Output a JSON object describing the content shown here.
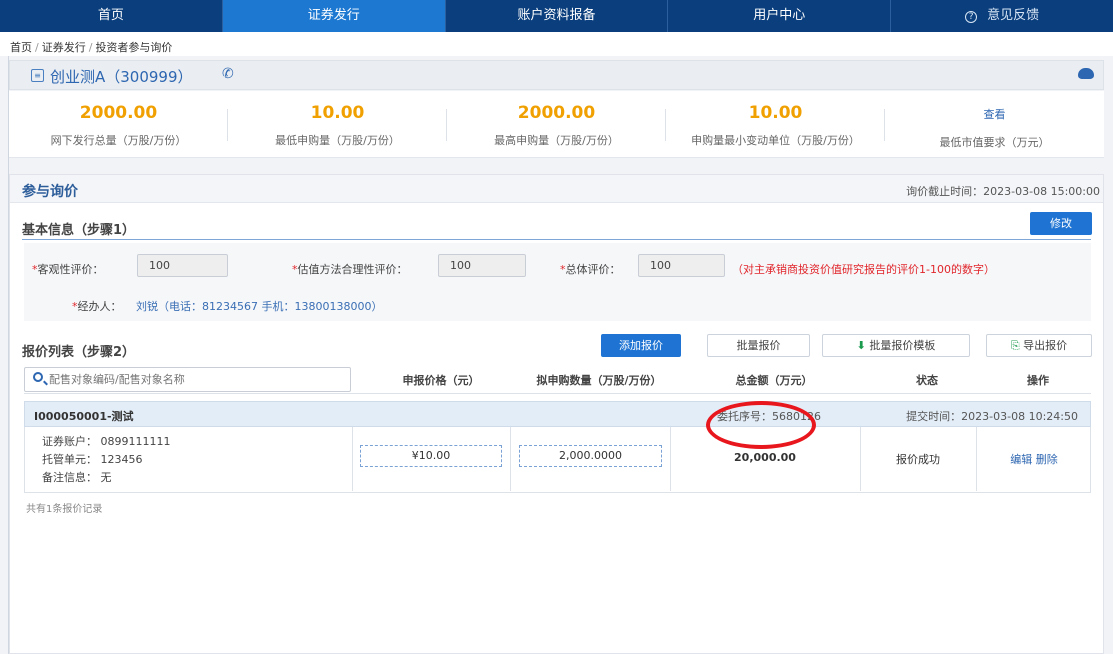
{
  "nav": {
    "home": "首页",
    "issuance": "证券发行",
    "account_report": "账户资料报备",
    "user_center": "用户中心",
    "feedback": "意见反馈"
  },
  "breadcrumb": {
    "home": "首页",
    "issuance": "证券发行",
    "current": "投资者参与询价"
  },
  "product": {
    "name": "创业测A（300999）"
  },
  "stats": [
    {
      "value": "2000.00",
      "label": "网下发行总量（万股/万份）"
    },
    {
      "value": "10.00",
      "label": "最低申购量（万股/万份）"
    },
    {
      "value": "2000.00",
      "label": "最高申购量（万股/万份）"
    },
    {
      "value": "10.00",
      "label": "申购量最小变动单位（万股/万份）"
    },
    {
      "value": "查看",
      "label": "最低市值要求（万元）"
    }
  ],
  "inquiry": {
    "title": "参与询价",
    "deadline": "询价截止时间：2023-03-08 15:00:00"
  },
  "basic_info": {
    "title": "基本信息（步骤1）",
    "modify_button": "修改",
    "objectivity_label": "客观性评价：",
    "objectivity_value": "100",
    "valuation_label": "估值方法合理性评价：",
    "valuation_value": "100",
    "overall_label": "总体评价：",
    "overall_value": "100",
    "hint": "（对主承销商投资价值研究报告的评价1-100的数字）",
    "handler_label": "经办人：",
    "handler_value": "刘锐（电话：81234567 手机：13800138000）"
  },
  "quote_list": {
    "title": "报价列表（步骤2）",
    "add_button": "添加报价",
    "batch_button": "批量报价",
    "template_button": "批量报价模板",
    "export_button": "导出报价",
    "search_placeholder": "配售对象编码/配售对象名称",
    "columns": {
      "price": "申报价格（元）",
      "quantity": "拟申购数量（万股/万份）",
      "amount": "总金额（万元）",
      "status": "状态",
      "action": "操作"
    },
    "group": {
      "name": "I000050001-测试",
      "seq_label": "委托序号：",
      "seq_value": "5680126",
      "submit_time": "提交时间：2023-03-08 10:24:50"
    },
    "row": {
      "account": "证券账户： 0899111111",
      "custody": "托管单元： 123456",
      "remark": "备注信息： 无",
      "price": "¥10.00",
      "quantity": "2,000.0000",
      "amount": "20,000.00",
      "status": "报价成功",
      "edit": "编辑",
      "delete": "删除"
    },
    "footnote": "共有1条报价记录"
  },
  "colors": {
    "nav_bg": "#0a3e7d",
    "nav_active": "#1d78d2",
    "stat_value": "#f0a000",
    "accent_blue": "#2d66b1",
    "annotation_red": "#e8171d"
  }
}
